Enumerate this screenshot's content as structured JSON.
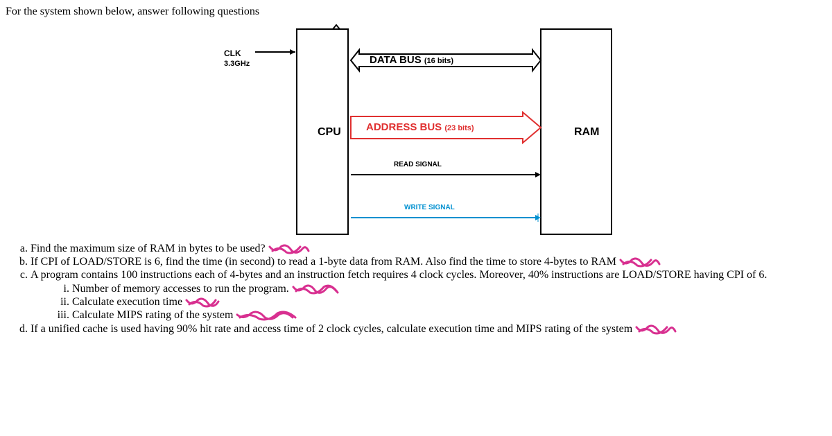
{
  "intro": "For the system shown below, answer following questions",
  "diagram": {
    "clk_label": "CLK",
    "clk_freq": "3.3GHz",
    "cpu": "CPU",
    "ram": "RAM",
    "data_bus": "DATA BUS",
    "data_bus_bits": "(16 bits)",
    "addr_bus": "ADDRESS BUS",
    "addr_bus_bits": "(23 bits)",
    "read_signal": "READ SIGNAL",
    "write_signal": "WRITE SIGNAL"
  },
  "q": {
    "a": "Find the maximum size of RAM in bytes to be used?",
    "b": "If CPI of LOAD/STORE is 6, find the time (in second) to read a 1-byte data from RAM. Also find the time to store 4-bytes to RAM",
    "c": "A program contains 100 instructions each of 4-bytes and an instruction fetch requires 4 clock cycles. Moreover, 40% instructions are LOAD/STORE having CPI of 6.",
    "c_i": "Number of memory accesses to run the program.",
    "c_ii": "Calculate execution time",
    "c_iii": "Calculate MIPS rating of the system",
    "d": "If a unified cache is used having 90% hit rate and access time of 2 clock cycles, calculate execution time and MIPS rating of the system"
  }
}
